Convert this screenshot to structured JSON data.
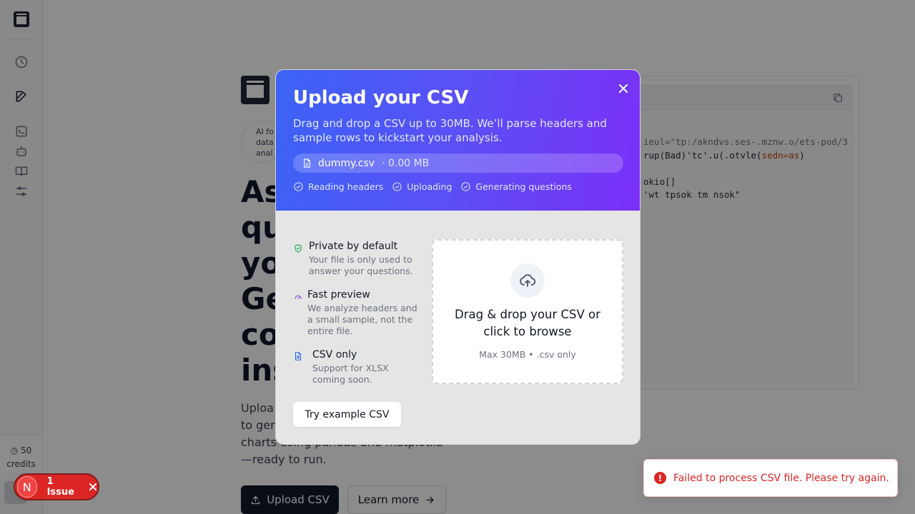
{
  "sidebar": {
    "credits_value": "50",
    "credits_label": "credits"
  },
  "hero": {
    "pill_lines": [
      "AI fo",
      "data",
      "anal"
    ],
    "title_lines": [
      "As",
      "que",
      "you",
      "Get",
      "cod",
      "insi"
    ],
    "desc_lines": [
      "Uploa",
      "to gene",
      "charts using pandas and matplotlib",
      "—ready to run."
    ],
    "upload_label": "Upload CSV",
    "learn_label": "Learn more"
  },
  "code": {
    "lines": [
      {
        "text": "ieul=\"tp:/akndvs.ses-.mznw.o/ets-pod/3",
        "cls": "c1"
      },
      {
        "text": "rup(Bad)'tc'.u(.otvle(",
        "cls": "",
        "tail": "sedn=as",
        "tail_after": ")"
      },
      {
        "text": "",
        "cls": ""
      },
      {
        "text": "okio[]",
        "cls": ""
      },
      {
        "text": "'wt tpsok tm nsok\"",
        "cls": ""
      }
    ]
  },
  "modal": {
    "title": "Upload your CSV",
    "subtitle": "Drag and drop a CSV up to 30MB. We’ll parse headers and sample rows to kickstart your analysis.",
    "file_name": "dummy.csv",
    "file_size": "· 0.00 MB",
    "steps": [
      "Reading headers",
      "Uploading",
      "Generating questions"
    ],
    "features": [
      {
        "title": "Private by default",
        "desc": "Your file is only used to answer your questions.",
        "icon": "shield-icon",
        "color": "#16a34a"
      },
      {
        "title": "Fast preview",
        "desc": "We analyze headers and a small sample, not the entire file.",
        "icon": "gauge-icon",
        "color": "#7c3aed"
      },
      {
        "title": "CSV only",
        "desc": "Support for XLSX coming soon.",
        "icon": "spreadsheet-icon",
        "color": "#2563eb"
      }
    ],
    "try_example_label": "Try example CSV",
    "dropzone_text": "Drag & drop your CSV or click to browse",
    "dropzone_hint": "Max 30MB • .csv only"
  },
  "toast": {
    "message": "Failed to process CSV file. Please try again."
  },
  "issues": {
    "badge": "N",
    "label": "1 Issue"
  },
  "colors": {
    "gradient_start": "#3b63f6",
    "gradient_end": "#7b2ff7",
    "error": "#dc2626"
  }
}
